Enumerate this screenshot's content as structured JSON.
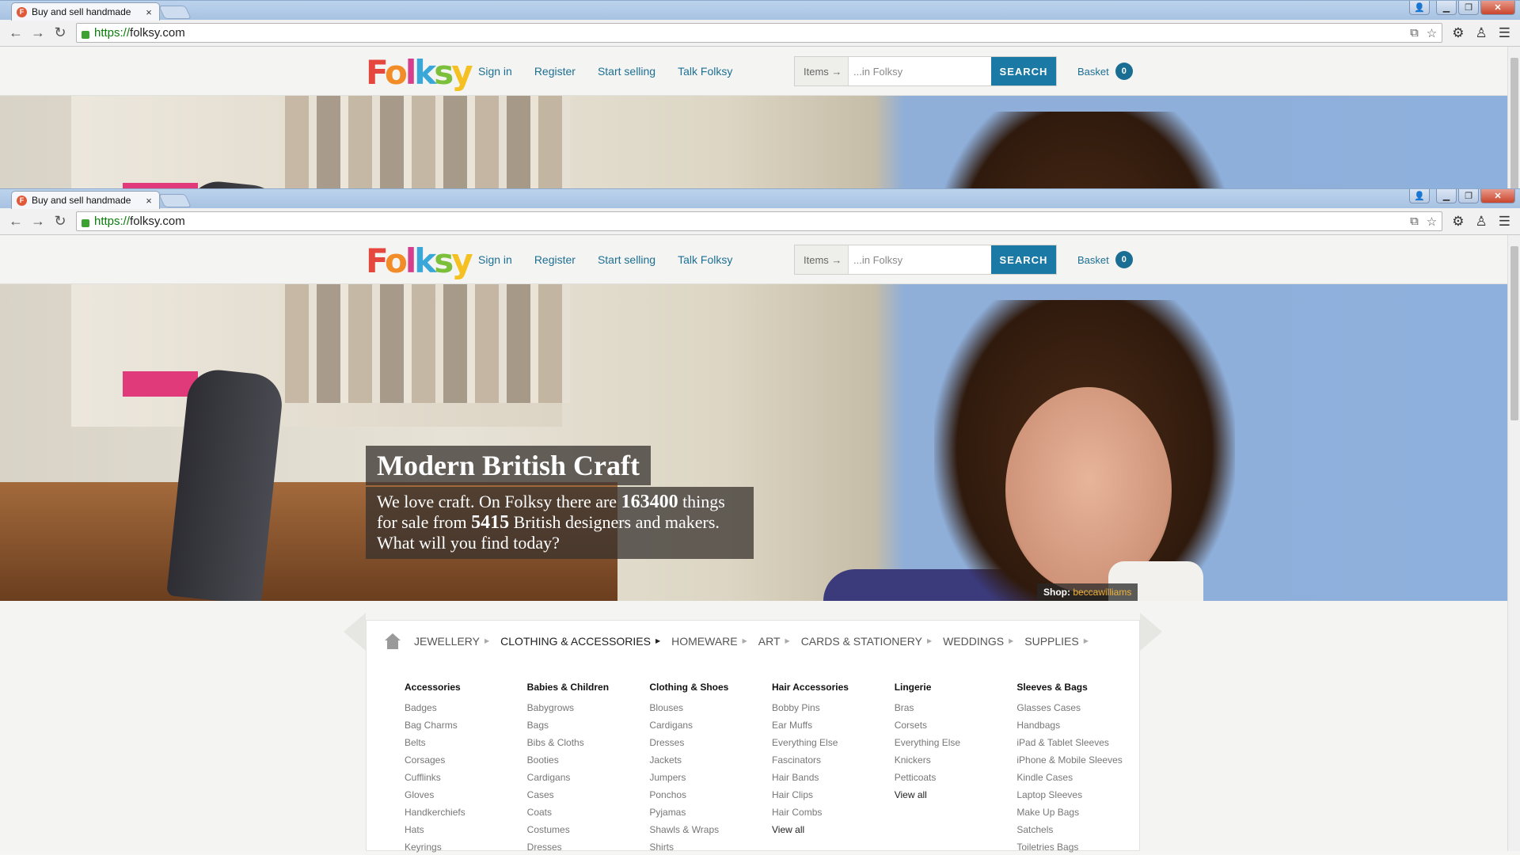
{
  "browser": {
    "tab_title": "Buy and sell handmade",
    "tab_close": "×",
    "url_protocol": "https://",
    "url_host": "folksy.com",
    "favicon_letter": "F"
  },
  "site": {
    "logo_letters": [
      "F",
      "o",
      "l",
      "k",
      "s",
      "y"
    ],
    "nav": {
      "sign_in": "Sign in",
      "register": "Register",
      "start_selling": "Start selling",
      "talk_folksy": "Talk Folksy"
    },
    "search": {
      "scope": "Items →",
      "placeholder": "...in Folksy",
      "button": "SEARCH"
    },
    "basket": {
      "label": "Basket",
      "count": "0"
    }
  },
  "hero": {
    "title": "Modern British Craft",
    "text_1": "We love craft. On Folksy there are ",
    "count_items": "163400",
    "text_2": " things for sale from ",
    "count_designers": "5415",
    "text_3": " British designers and makers. What will you find today?",
    "shop_label": "Shop: ",
    "shop_name": "beccawilliams"
  },
  "categories": [
    {
      "label": "JEWELLERY"
    },
    {
      "label": "CLOTHING & ACCESSORIES"
    },
    {
      "label": "HOMEWARE"
    },
    {
      "label": "ART"
    },
    {
      "label": "CARDS & STATIONERY"
    },
    {
      "label": "WEDDINGS"
    },
    {
      "label": "SUPPLIES"
    }
  ],
  "menu": {
    "columns": [
      {
        "head": "Accessories",
        "items": [
          "Badges",
          "Bag Charms",
          "Belts",
          "Corsages",
          "Cufflinks",
          "Gloves",
          "Handkerchiefs",
          "Hats",
          "Keyrings"
        ]
      },
      {
        "head": "Babies & Children",
        "items": [
          "Babygrows",
          "Bags",
          "Bibs & Cloths",
          "Booties",
          "Cardigans",
          "Cases",
          "Coats",
          "Costumes",
          "Dresses"
        ]
      },
      {
        "head": "Clothing & Shoes",
        "items": [
          "Blouses",
          "Cardigans",
          "Dresses",
          "Jackets",
          "Jumpers",
          "Ponchos",
          "Pyjamas",
          "Shawls & Wraps",
          "Shirts"
        ]
      },
      {
        "head": "Hair Accessories",
        "items": [
          "Bobby Pins",
          "Ear Muffs",
          "Everything Else",
          "Fascinators",
          "Hair Bands",
          "Hair Clips",
          "Hair Combs"
        ],
        "view_all": "View all"
      },
      {
        "head": "Lingerie",
        "items": [
          "Bras",
          "Corsets",
          "Everything Else",
          "Knickers",
          "Petticoats"
        ],
        "view_all": "View all"
      },
      {
        "head": "Sleeves & Bags",
        "items": [
          "Glasses Cases",
          "Handbags",
          "iPad & Tablet Sleeves",
          "iPhone & Mobile Sleeves",
          "Kindle Cases",
          "Laptop Sleeves",
          "Make Up Bags",
          "Satchels",
          "Toiletries Bags"
        ]
      }
    ]
  },
  "colors": {
    "link": "#1d6f94",
    "search_button": "#1b7aa5",
    "basket_badge": "#1b6e93",
    "shop_credit_name": "#f0b33a"
  }
}
